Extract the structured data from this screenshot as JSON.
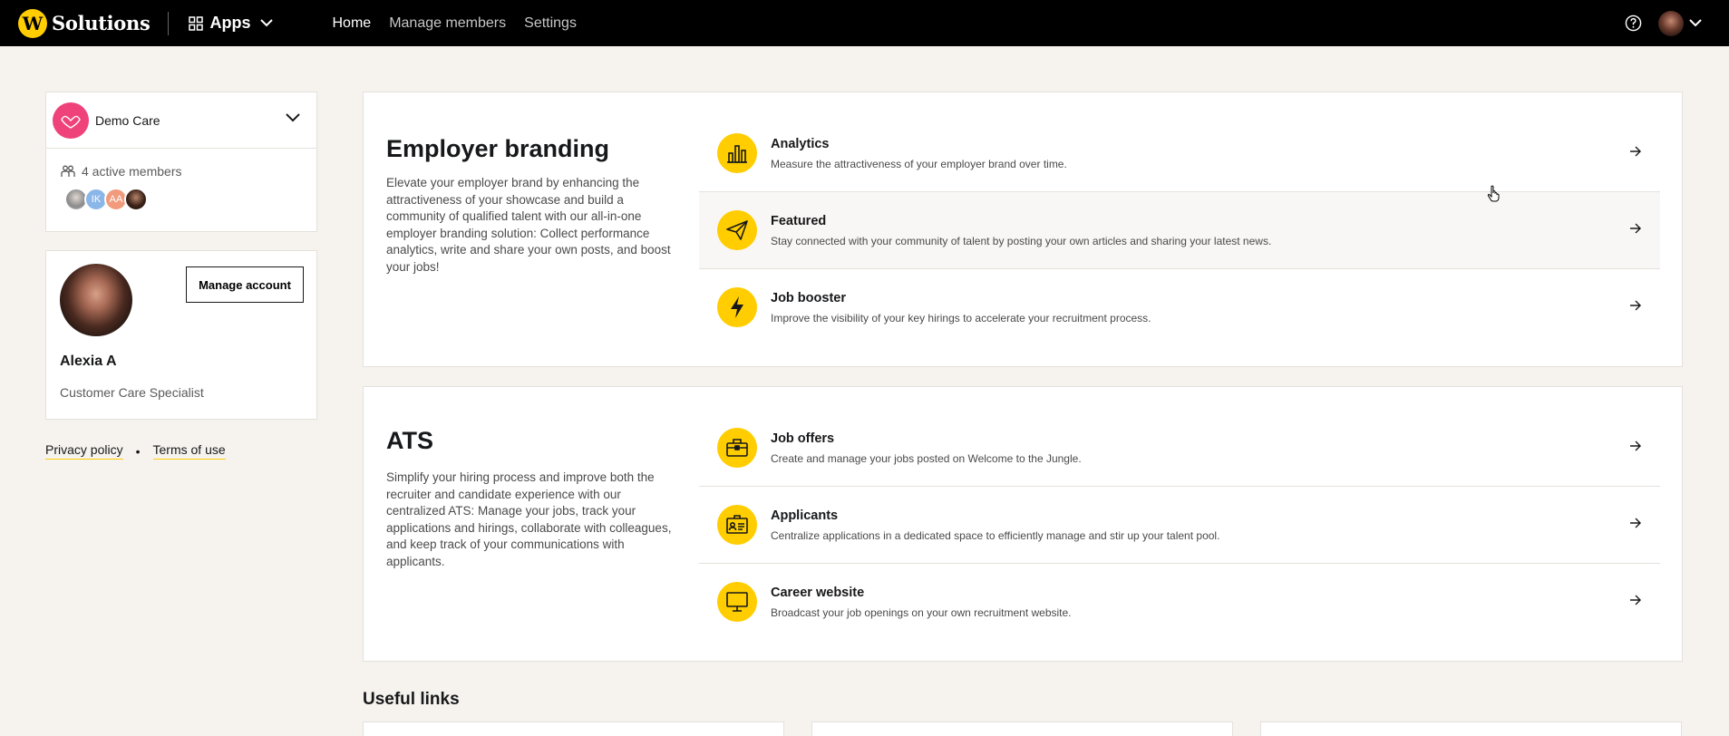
{
  "topbar": {
    "logo_letter": "W",
    "logo_text": "Solutions",
    "apps_label": "Apps",
    "nav": [
      "Home",
      "Manage members",
      "Settings"
    ],
    "help_icon": "help-circle-icon",
    "user_menu_icon": "chevron-down-icon"
  },
  "company": {
    "name": "Demo Care",
    "members_text": "4 active members",
    "member_avatars": [
      "",
      "IK",
      "AA",
      ""
    ]
  },
  "profile": {
    "manage_label": "Manage account",
    "name": "Alexia A",
    "role": "Customer Care Specialist"
  },
  "footer": {
    "privacy": "Privacy policy",
    "separator": "•",
    "terms": "Terms of use"
  },
  "employer_branding": {
    "title": "Employer branding",
    "description": "Elevate your employer brand by enhancing the attractiveness of your showcase and build a community of qualified talent with our all-in-one employer branding solution: Collect performance analytics, write and share your own posts, and boost your jobs!",
    "items": [
      {
        "icon": "bar-chart-icon",
        "title": "Analytics",
        "desc": "Measure the attractiveness of your employer brand over time."
      },
      {
        "icon": "paper-plane-icon",
        "title": "Featured",
        "desc": "Stay connected with your community of talent by posting your own articles and sharing your latest news."
      },
      {
        "icon": "lightning-icon",
        "title": "Job booster",
        "desc": "Improve the visibility of your key hirings to accelerate your recruitment process."
      }
    ]
  },
  "ats": {
    "title": "ATS",
    "description": "Simplify your hiring process and improve both the recruiter and candidate experience with our centralized ATS: Manage your jobs, track your applications and hirings, collaborate with colleagues, and keep track of your communications with applicants.",
    "items": [
      {
        "icon": "briefcase-icon",
        "title": "Job offers",
        "desc": "Create and manage your jobs posted on Welcome to the Jungle."
      },
      {
        "icon": "id-card-icon",
        "title": "Applicants",
        "desc": "Centralize applications in a dedicated space to efficiently manage and stir up your talent pool."
      },
      {
        "icon": "monitor-icon",
        "title": "Career website",
        "desc": "Broadcast your job openings on your own recruitment website."
      }
    ]
  },
  "useful_links": {
    "title": "Useful links"
  },
  "colors": {
    "accent": "#ffcd00",
    "topbar": "#000000",
    "background": "#f6f3ef",
    "company_logo": "#f0427a"
  }
}
